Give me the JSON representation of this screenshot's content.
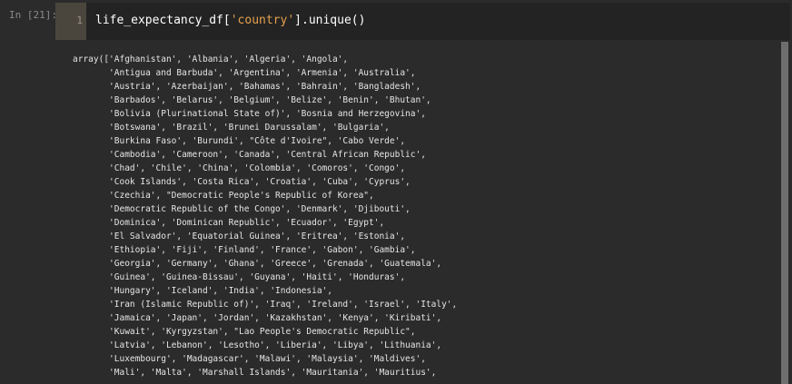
{
  "cell": {
    "prompt": "In [21]:",
    "line_number": "1",
    "code": {
      "prefix": "life_expectancy_df[",
      "string": "'country'",
      "suffix": "].unique()"
    }
  },
  "output": {
    "lines": [
      "array(['Afghanistan', 'Albania', 'Algeria', 'Angola',",
      "       'Antigua and Barbuda', 'Argentina', 'Armenia', 'Australia',",
      "       'Austria', 'Azerbaijan', 'Bahamas', 'Bahrain', 'Bangladesh',",
      "       'Barbados', 'Belarus', 'Belgium', 'Belize', 'Benin', 'Bhutan',",
      "       'Bolivia (Plurinational State of)', 'Bosnia and Herzegovina',",
      "       'Botswana', 'Brazil', 'Brunei Darussalam', 'Bulgaria',",
      "       'Burkina Faso', 'Burundi', \"Côte d'Ivoire\", 'Cabo Verde',",
      "       'Cambodia', 'Cameroon', 'Canada', 'Central African Republic',",
      "       'Chad', 'Chile', 'China', 'Colombia', 'Comoros', 'Congo',",
      "       'Cook Islands', 'Costa Rica', 'Croatia', 'Cuba', 'Cyprus',",
      "       'Czechia', \"Democratic People's Republic of Korea\",",
      "       'Democratic Republic of the Congo', 'Denmark', 'Djibouti',",
      "       'Dominica', 'Dominican Republic', 'Ecuador', 'Egypt',",
      "       'El Salvador', 'Equatorial Guinea', 'Eritrea', 'Estonia',",
      "       'Ethiopia', 'Fiji', 'Finland', 'France', 'Gabon', 'Gambia',",
      "       'Georgia', 'Germany', 'Ghana', 'Greece', 'Grenada', 'Guatemala',",
      "       'Guinea', 'Guinea-Bissau', 'Guyana', 'Haiti', 'Honduras',",
      "       'Hungary', 'Iceland', 'India', 'Indonesia',",
      "       'Iran (Islamic Republic of)', 'Iraq', 'Ireland', 'Israel', 'Italy',",
      "       'Jamaica', 'Japan', 'Jordan', 'Kazakhstan', 'Kenya', 'Kiribati',",
      "       'Kuwait', 'Kyrgyzstan', \"Lao People's Democratic Republic\",",
      "       'Latvia', 'Lebanon', 'Lesotho', 'Liberia', 'Libya', 'Lithuania',",
      "       'Luxembourg', 'Madagascar', 'Malawi', 'Malaysia', 'Maldives',",
      "       'Mali', 'Malta', 'Marshall Islands', 'Mauritania', 'Mauritius',"
    ]
  },
  "colors": {
    "background": "#2b2b2b",
    "editor_background": "#232323",
    "gutter": "#4a463e",
    "string_literal": "#e6a14e",
    "output_text": "#e6e6e6"
  }
}
